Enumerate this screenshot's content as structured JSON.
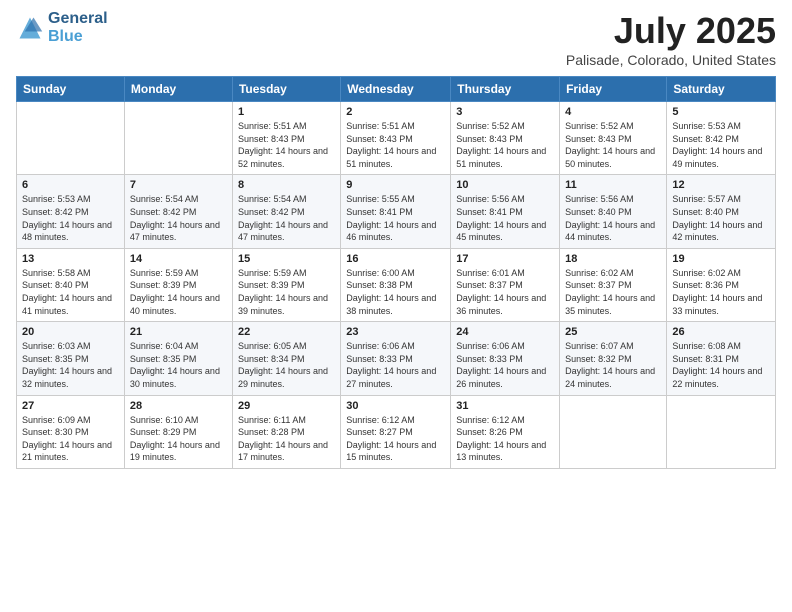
{
  "header": {
    "logo_general": "General",
    "logo_blue": "Blue",
    "title": "July 2025",
    "location": "Palisade, Colorado, United States"
  },
  "days_of_week": [
    "Sunday",
    "Monday",
    "Tuesday",
    "Wednesday",
    "Thursday",
    "Friday",
    "Saturday"
  ],
  "weeks": [
    [
      {
        "day": "",
        "info": ""
      },
      {
        "day": "",
        "info": ""
      },
      {
        "day": "1",
        "info": "Sunrise: 5:51 AM\nSunset: 8:43 PM\nDaylight: 14 hours and 52 minutes."
      },
      {
        "day": "2",
        "info": "Sunrise: 5:51 AM\nSunset: 8:43 PM\nDaylight: 14 hours and 51 minutes."
      },
      {
        "day": "3",
        "info": "Sunrise: 5:52 AM\nSunset: 8:43 PM\nDaylight: 14 hours and 51 minutes."
      },
      {
        "day": "4",
        "info": "Sunrise: 5:52 AM\nSunset: 8:43 PM\nDaylight: 14 hours and 50 minutes."
      },
      {
        "day": "5",
        "info": "Sunrise: 5:53 AM\nSunset: 8:42 PM\nDaylight: 14 hours and 49 minutes."
      }
    ],
    [
      {
        "day": "6",
        "info": "Sunrise: 5:53 AM\nSunset: 8:42 PM\nDaylight: 14 hours and 48 minutes."
      },
      {
        "day": "7",
        "info": "Sunrise: 5:54 AM\nSunset: 8:42 PM\nDaylight: 14 hours and 47 minutes."
      },
      {
        "day": "8",
        "info": "Sunrise: 5:54 AM\nSunset: 8:42 PM\nDaylight: 14 hours and 47 minutes."
      },
      {
        "day": "9",
        "info": "Sunrise: 5:55 AM\nSunset: 8:41 PM\nDaylight: 14 hours and 46 minutes."
      },
      {
        "day": "10",
        "info": "Sunrise: 5:56 AM\nSunset: 8:41 PM\nDaylight: 14 hours and 45 minutes."
      },
      {
        "day": "11",
        "info": "Sunrise: 5:56 AM\nSunset: 8:40 PM\nDaylight: 14 hours and 44 minutes."
      },
      {
        "day": "12",
        "info": "Sunrise: 5:57 AM\nSunset: 8:40 PM\nDaylight: 14 hours and 42 minutes."
      }
    ],
    [
      {
        "day": "13",
        "info": "Sunrise: 5:58 AM\nSunset: 8:40 PM\nDaylight: 14 hours and 41 minutes."
      },
      {
        "day": "14",
        "info": "Sunrise: 5:59 AM\nSunset: 8:39 PM\nDaylight: 14 hours and 40 minutes."
      },
      {
        "day": "15",
        "info": "Sunrise: 5:59 AM\nSunset: 8:39 PM\nDaylight: 14 hours and 39 minutes."
      },
      {
        "day": "16",
        "info": "Sunrise: 6:00 AM\nSunset: 8:38 PM\nDaylight: 14 hours and 38 minutes."
      },
      {
        "day": "17",
        "info": "Sunrise: 6:01 AM\nSunset: 8:37 PM\nDaylight: 14 hours and 36 minutes."
      },
      {
        "day": "18",
        "info": "Sunrise: 6:02 AM\nSunset: 8:37 PM\nDaylight: 14 hours and 35 minutes."
      },
      {
        "day": "19",
        "info": "Sunrise: 6:02 AM\nSunset: 8:36 PM\nDaylight: 14 hours and 33 minutes."
      }
    ],
    [
      {
        "day": "20",
        "info": "Sunrise: 6:03 AM\nSunset: 8:35 PM\nDaylight: 14 hours and 32 minutes."
      },
      {
        "day": "21",
        "info": "Sunrise: 6:04 AM\nSunset: 8:35 PM\nDaylight: 14 hours and 30 minutes."
      },
      {
        "day": "22",
        "info": "Sunrise: 6:05 AM\nSunset: 8:34 PM\nDaylight: 14 hours and 29 minutes."
      },
      {
        "day": "23",
        "info": "Sunrise: 6:06 AM\nSunset: 8:33 PM\nDaylight: 14 hours and 27 minutes."
      },
      {
        "day": "24",
        "info": "Sunrise: 6:06 AM\nSunset: 8:33 PM\nDaylight: 14 hours and 26 minutes."
      },
      {
        "day": "25",
        "info": "Sunrise: 6:07 AM\nSunset: 8:32 PM\nDaylight: 14 hours and 24 minutes."
      },
      {
        "day": "26",
        "info": "Sunrise: 6:08 AM\nSunset: 8:31 PM\nDaylight: 14 hours and 22 minutes."
      }
    ],
    [
      {
        "day": "27",
        "info": "Sunrise: 6:09 AM\nSunset: 8:30 PM\nDaylight: 14 hours and 21 minutes."
      },
      {
        "day": "28",
        "info": "Sunrise: 6:10 AM\nSunset: 8:29 PM\nDaylight: 14 hours and 19 minutes."
      },
      {
        "day": "29",
        "info": "Sunrise: 6:11 AM\nSunset: 8:28 PM\nDaylight: 14 hours and 17 minutes."
      },
      {
        "day": "30",
        "info": "Sunrise: 6:12 AM\nSunset: 8:27 PM\nDaylight: 14 hours and 15 minutes."
      },
      {
        "day": "31",
        "info": "Sunrise: 6:12 AM\nSunset: 8:26 PM\nDaylight: 14 hours and 13 minutes."
      },
      {
        "day": "",
        "info": ""
      },
      {
        "day": "",
        "info": ""
      }
    ]
  ]
}
